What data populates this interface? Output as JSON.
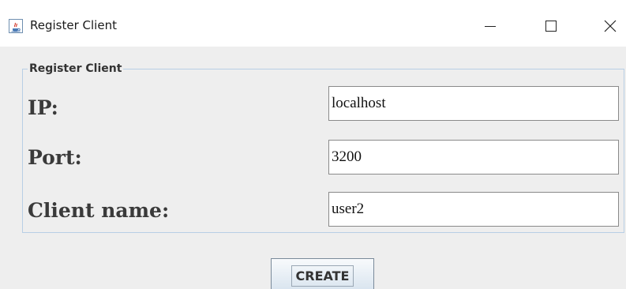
{
  "window": {
    "title": "Register Client",
    "icon": "java-cup-icon",
    "controls": [
      "minimize",
      "maximize",
      "close"
    ]
  },
  "form": {
    "group_title": "Register Client",
    "fields": [
      {
        "label": "IP:",
        "value": "localhost"
      },
      {
        "label": "Port:",
        "value": "3200"
      },
      {
        "label": "Client name:",
        "value": "user2"
      }
    ],
    "submit_label": "CREATE"
  }
}
